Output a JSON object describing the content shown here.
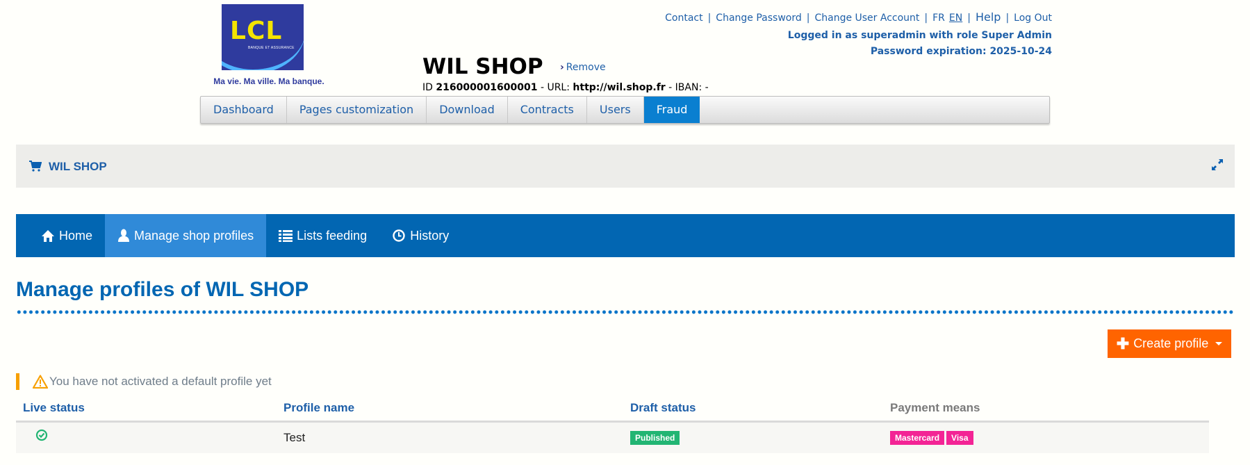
{
  "colors": {
    "primary_blue": "#0266b2",
    "active_nav": "#308ad8",
    "top_tab_active": "#0a7fd0",
    "link_blue": "#1e5fa8",
    "orange": "#ff6400",
    "warning": "#f7a000",
    "published_green": "#22b573",
    "payment_pink": "#f32495"
  },
  "logo": {
    "brand": "LCL",
    "subtitle": "BANQUE ET ASSURANCE",
    "tagline": "Ma vie. Ma ville. Ma banque."
  },
  "top_links": {
    "contact": "Contact",
    "change_password": "Change Password",
    "change_user_account": "Change User Account",
    "lang_fr": "FR",
    "lang_en": "EN",
    "help": "Help",
    "log_out": "Log Out",
    "separator": "|"
  },
  "user_info": {
    "logged_in": "Logged in as superadmin with role Super Admin",
    "password_expiration": "Password expiration: 2025-10-24"
  },
  "shop": {
    "title": "WIL SHOP",
    "remove_label": "Remove",
    "id_label": "ID",
    "id_value": "216000001600001",
    "url_label": "- URL:",
    "url_value": "http://wil.shop.fr",
    "iban_label": "- IBAN: -"
  },
  "top_tabs": [
    {
      "label": "Dashboard",
      "active": false
    },
    {
      "label": "Pages customization",
      "active": false
    },
    {
      "label": "Download",
      "active": false
    },
    {
      "label": "Contracts",
      "active": false
    },
    {
      "label": "Users",
      "active": false
    },
    {
      "label": "Fraud",
      "active": true
    }
  ],
  "shop_bar": {
    "icon": "shopping-cart-icon",
    "name": "WIL SHOP",
    "expand_icon": "expand-icon"
  },
  "main_nav": [
    {
      "label": "Home",
      "icon": "home-icon",
      "active": false
    },
    {
      "label": "Manage shop profiles",
      "icon": "user-icon",
      "active": true
    },
    {
      "label": "Lists feeding",
      "icon": "list-icon",
      "active": false
    },
    {
      "label": "History",
      "icon": "clock-icon",
      "active": false
    }
  ],
  "content": {
    "page_title": "Manage profiles of WIL SHOP",
    "create_button": "Create profile",
    "warning": "You have not activated a default profile yet"
  },
  "table": {
    "columns": [
      "Live status",
      "Profile name",
      "Draft status",
      "Payment means"
    ],
    "rows": [
      {
        "live_status": "active",
        "profile_name": "Test",
        "draft_status": "Published",
        "payment_means": [
          "Mastercard",
          "Visa"
        ]
      }
    ]
  }
}
